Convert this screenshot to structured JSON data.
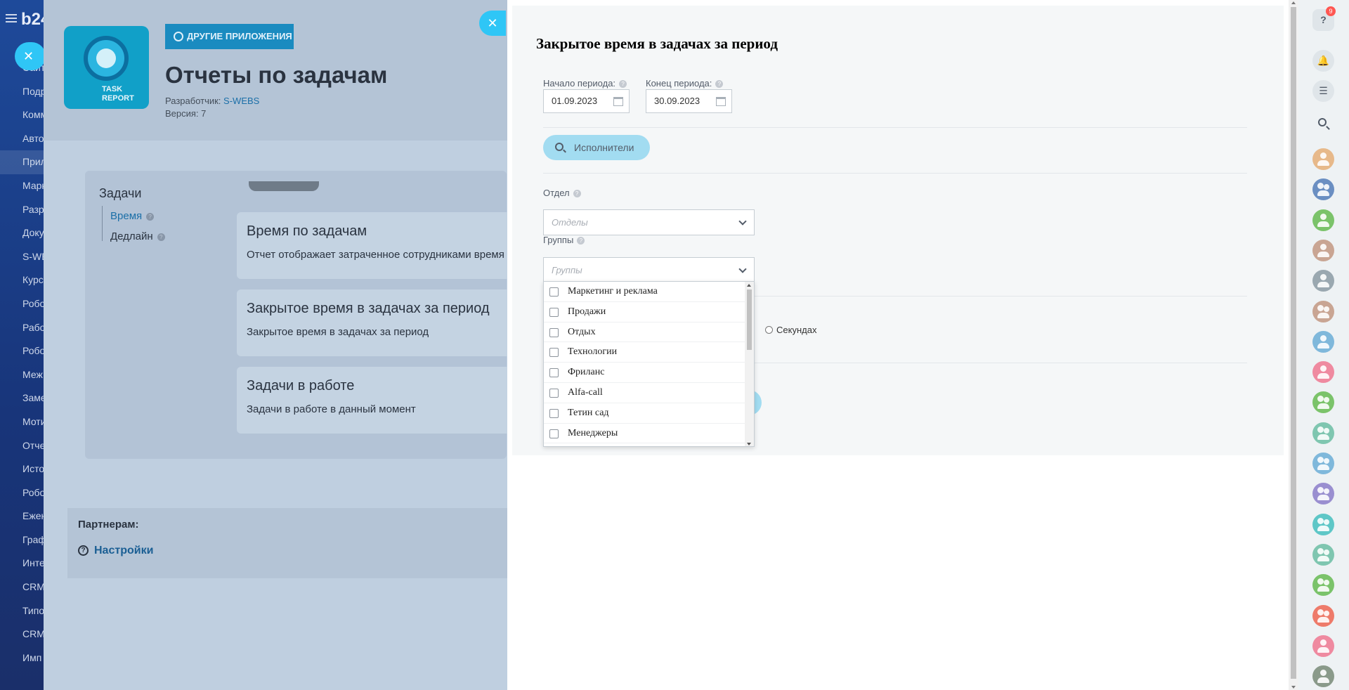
{
  "portal": {
    "logo": "b24",
    "menu_items": [
      "Сайт",
      "Подр",
      "Комм",
      "Авто",
      "Прил",
      "Марк",
      "Разр",
      "Доку",
      "S-WE",
      "Курс",
      "Робо",
      "Рабо",
      "Робо",
      "Меж",
      "Заме",
      "Моти",
      "Отче",
      "Исто",
      "Робо",
      "Ежен",
      "Граф",
      "Инте",
      "CRM",
      "Типо",
      "CRM",
      "Имп"
    ]
  },
  "app": {
    "other_apps_label": "ДРУГИЕ ПРИЛОЖЕНИЯ",
    "title": "Отчеты по задачам",
    "developer_label": "Разработчик:",
    "developer_name": "S-WEBS",
    "version": "Версия: 7",
    "icon_text_line1": "TASK",
    "icon_text_line2": "REPORT",
    "tasks_heading": "Задачи",
    "tree": [
      {
        "label": "Время",
        "active": true
      },
      {
        "label": "Дедлайн",
        "active": false
      }
    ],
    "reports": [
      {
        "title": "Время по задачам",
        "desc": "Отчет отображает затраченное сотрудниками время п"
      },
      {
        "title": "Закрытое время в задачах за период",
        "desc": "Закрытое время в задачах за период"
      },
      {
        "title": "Задачи в работе",
        "desc": "Задачи в работе в данный момент"
      }
    ],
    "partners_label": "Партнерам:",
    "settings_label": "Настройки"
  },
  "slider": {
    "title": "Закрытое время в задачах за период",
    "start_label": "Начало периода:",
    "start_value": "01.09.2023",
    "end_label": "Конец периода:",
    "end_value": "30.09.2023",
    "performers_label": "Исполнители",
    "department_label": "Отдел",
    "department_placeholder": "Отделы",
    "groups_label": "Группы",
    "groups_placeholder": "Группы",
    "group_options": [
      "Маркетинг и реклама",
      "Продажи",
      "Отдых",
      "Технологии",
      "Фриланс",
      "Alfa-call",
      "Тетин сад",
      "Менеджеры"
    ],
    "seconds_label": "Секундах"
  },
  "rail": {
    "help_badge": "9",
    "avatar_colors": [
      "#e7b98a",
      "#6b8fc2",
      "#7bc36a",
      "#c9a593",
      "#9aa8b0",
      "#c9a593",
      "#7fb8db",
      "#ef8aa0",
      "#7bc36a",
      "#7fc6b0",
      "#7fb8db",
      "#9a8fd0",
      "#5ec7c7",
      "#7fc6b0",
      "#7bc36a",
      "#ee7b6a",
      "#ef8aa0",
      "#8a9a8a"
    ]
  },
  "colors": {
    "accent": "#2fc6f6",
    "link": "#1b6fa8",
    "badge": "#ff5752"
  }
}
